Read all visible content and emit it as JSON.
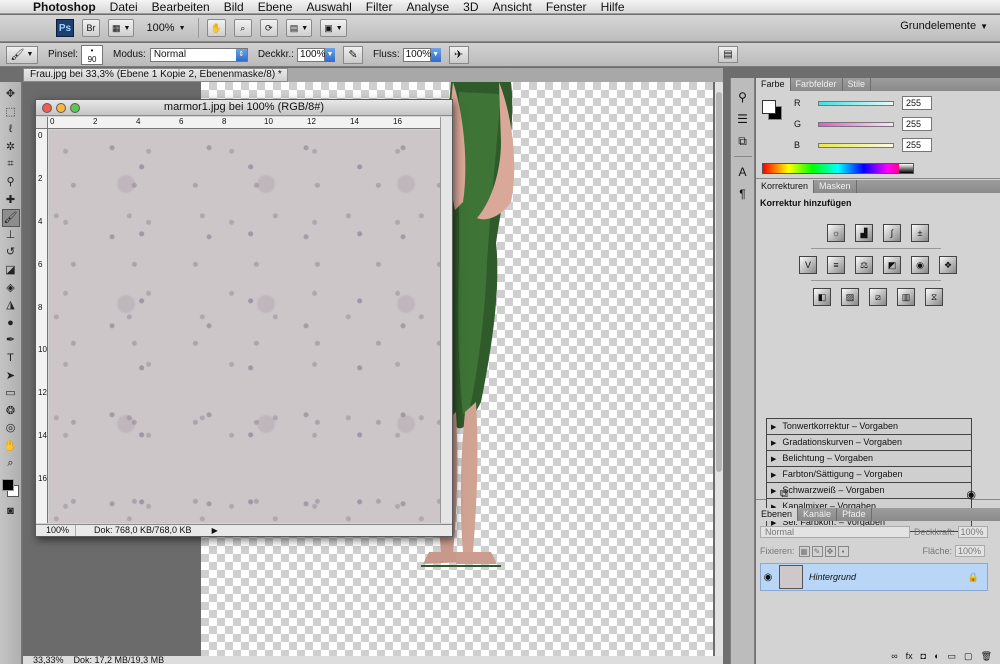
{
  "menubar": {
    "apple": "",
    "items": [
      "Photoshop",
      "Datei",
      "Bearbeiten",
      "Bild",
      "Ebene",
      "Auswahl",
      "Filter",
      "Analyse",
      "3D",
      "Ansicht",
      "Fenster",
      "Hilfe"
    ]
  },
  "appbar": {
    "ps_logo": "Ps",
    "bridge": "Br",
    "zoom": "100%",
    "workspace": "Grundelemente"
  },
  "options": {
    "brush_label": "Pinsel:",
    "brush_size": "90",
    "mode_label": "Modus:",
    "mode_value": "Normal",
    "opacity_label": "Deckkr.:",
    "opacity_value": "100%",
    "flow_label": "Fluss:",
    "flow_value": "100%"
  },
  "document": {
    "tab_title": "Frau.jpg bei 33,3% (Ebene 1 Kopie 2, Ebenenmaske/8) *",
    "status_zoom": "33,33%",
    "status_info": "Dok: 17,2 MB/19,3 MB"
  },
  "floating": {
    "title": "marmor1.jpg bei 100% (RGB/8#)",
    "ruler_h": [
      "0",
      "2",
      "4",
      "6",
      "8",
      "10",
      "12",
      "14",
      "16"
    ],
    "ruler_v": [
      "0",
      "2",
      "4",
      "6",
      "8",
      "10",
      "12",
      "14",
      "16"
    ],
    "zoom": "100%",
    "info": "Dok: 768,0 KB/768,0 KB"
  },
  "color_panel": {
    "tabs": [
      "Farbe",
      "Farbfelder",
      "Stile"
    ],
    "r_label": "R",
    "r_value": "255",
    "g_label": "G",
    "g_value": "255",
    "b_label": "B",
    "b_value": "255"
  },
  "adjust_panel": {
    "tabs": [
      "Korrekturen",
      "Masken"
    ],
    "title": "Korrektur hinzufügen",
    "presets": [
      "Tonwertkorrektur – Vorgaben",
      "Gradationskurven – Vorgaben",
      "Belichtung – Vorgaben",
      "Farbton/Sättigung – Vorgaben",
      "Schwarzweiß – Vorgaben",
      "Kanalmixer – Vorgaben",
      "Sel. Farbkorr. – Vorgaben"
    ]
  },
  "layers_panel": {
    "tabs": [
      "Ebenen",
      "Kanäle",
      "Pfade"
    ],
    "blend_mode": "Normal",
    "opacity_label": "Deckkraft:",
    "opacity_value": "100%",
    "lock_label": "Fixieren:",
    "fill_label": "Fläche:",
    "fill_value": "100%",
    "layer_name": "Hintergrund"
  },
  "colors": {
    "accent": "#b9d6f7",
    "r_bar": "#44dde0",
    "g_bar": "#e055d8",
    "b_bar": "#e8e84a"
  }
}
